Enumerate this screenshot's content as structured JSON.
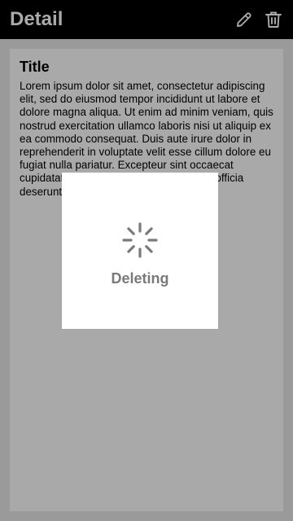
{
  "app_bar": {
    "title": "Detail",
    "actions": [
      {
        "icon": "pencil-icon",
        "label": "edit"
      },
      {
        "icon": "trash-icon",
        "label": "delete"
      }
    ]
  },
  "detail": {
    "title": "Title",
    "body": "Lorem ipsum dolor sit amet, consectetur adipiscing elit, sed do eiusmod tempor incididunt ut labore et dolore magna aliqua. Ut enim ad minim veniam, quis nostrud exercitation ullamco laboris nisi ut aliquip ex ea commodo consequat. Duis aute irure dolor in reprehenderit in voluptate velit esse cillum dolore eu fugiat nulla pariatur. Excepteur sint occaecat cupidatat non proident, sunt in culpa qui officia deserunt mollit anim id est laborum."
  },
  "loading_dialog": {
    "label": "Deleting",
    "icon": "spinner-icon"
  },
  "colors": {
    "app_bar_background": "#000000",
    "app_bar_foreground": "#aaaaaa",
    "scrim": "#9a9a9a",
    "card_background": "#a9a9a9",
    "dialog_background": "#ffffff",
    "dialog_text": "#7a7a7a"
  }
}
